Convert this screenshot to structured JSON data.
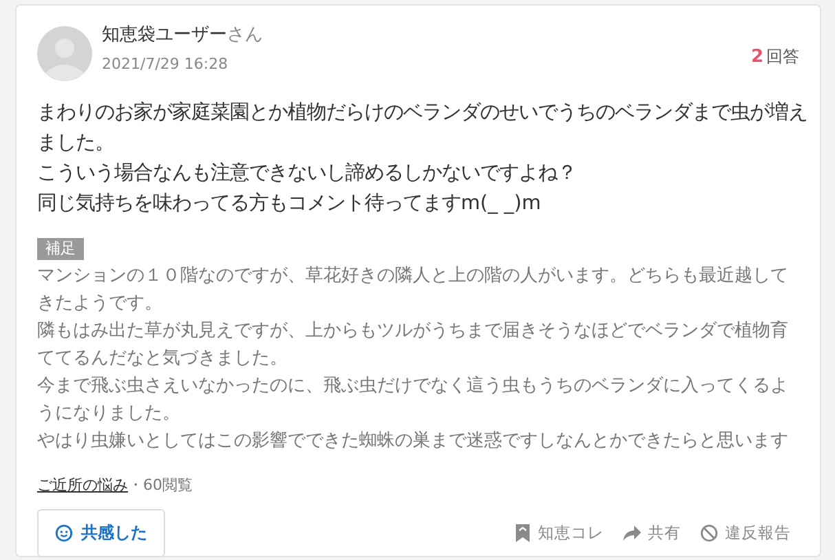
{
  "question": {
    "user": {
      "name": "知恵袋ユーザー",
      "suffix": "さん",
      "date": "2021/7/29 16:28"
    },
    "answers": {
      "count": "2",
      "label": "回答"
    },
    "body": [
      "まわりのお家が家庭菜園とか植物だらけのベランダのせいでうちのベランダまで虫が増えました。",
      "こういう場合なんも注意できないし諦めるしかないですよね？",
      "同じ気持ちを味わってる方もコメント待ってますm(_ _)m"
    ],
    "supplement": {
      "label": "補足",
      "paragraphs": [
        "マンションの１０階なのですが、草花好きの隣人と上の階の人がいます。どちらも最近越してきたようです。",
        "隣もはみ出た草が丸見えですが、上からもツルがうちまで届きそうなほどでベランダで植物育ててるんだなと気づきました。",
        "今まで飛ぶ虫さえいなかったのに、飛ぶ虫だけでなく這う虫もうちのベランダに入ってくるようになりました。",
        "やはり虫嫌いとしてはこの影響でできた蜘蛛の巣まで迷惑ですしなんとかできたらと思います"
      ]
    },
    "category": "ご近所の悩み",
    "views": "・60閲覧",
    "empathy_button": "共感した",
    "actions": [
      {
        "kind": "bookmark",
        "label": "知恵コレ"
      },
      {
        "kind": "share",
        "label": "共有"
      },
      {
        "kind": "report",
        "label": "違反報告"
      }
    ]
  }
}
